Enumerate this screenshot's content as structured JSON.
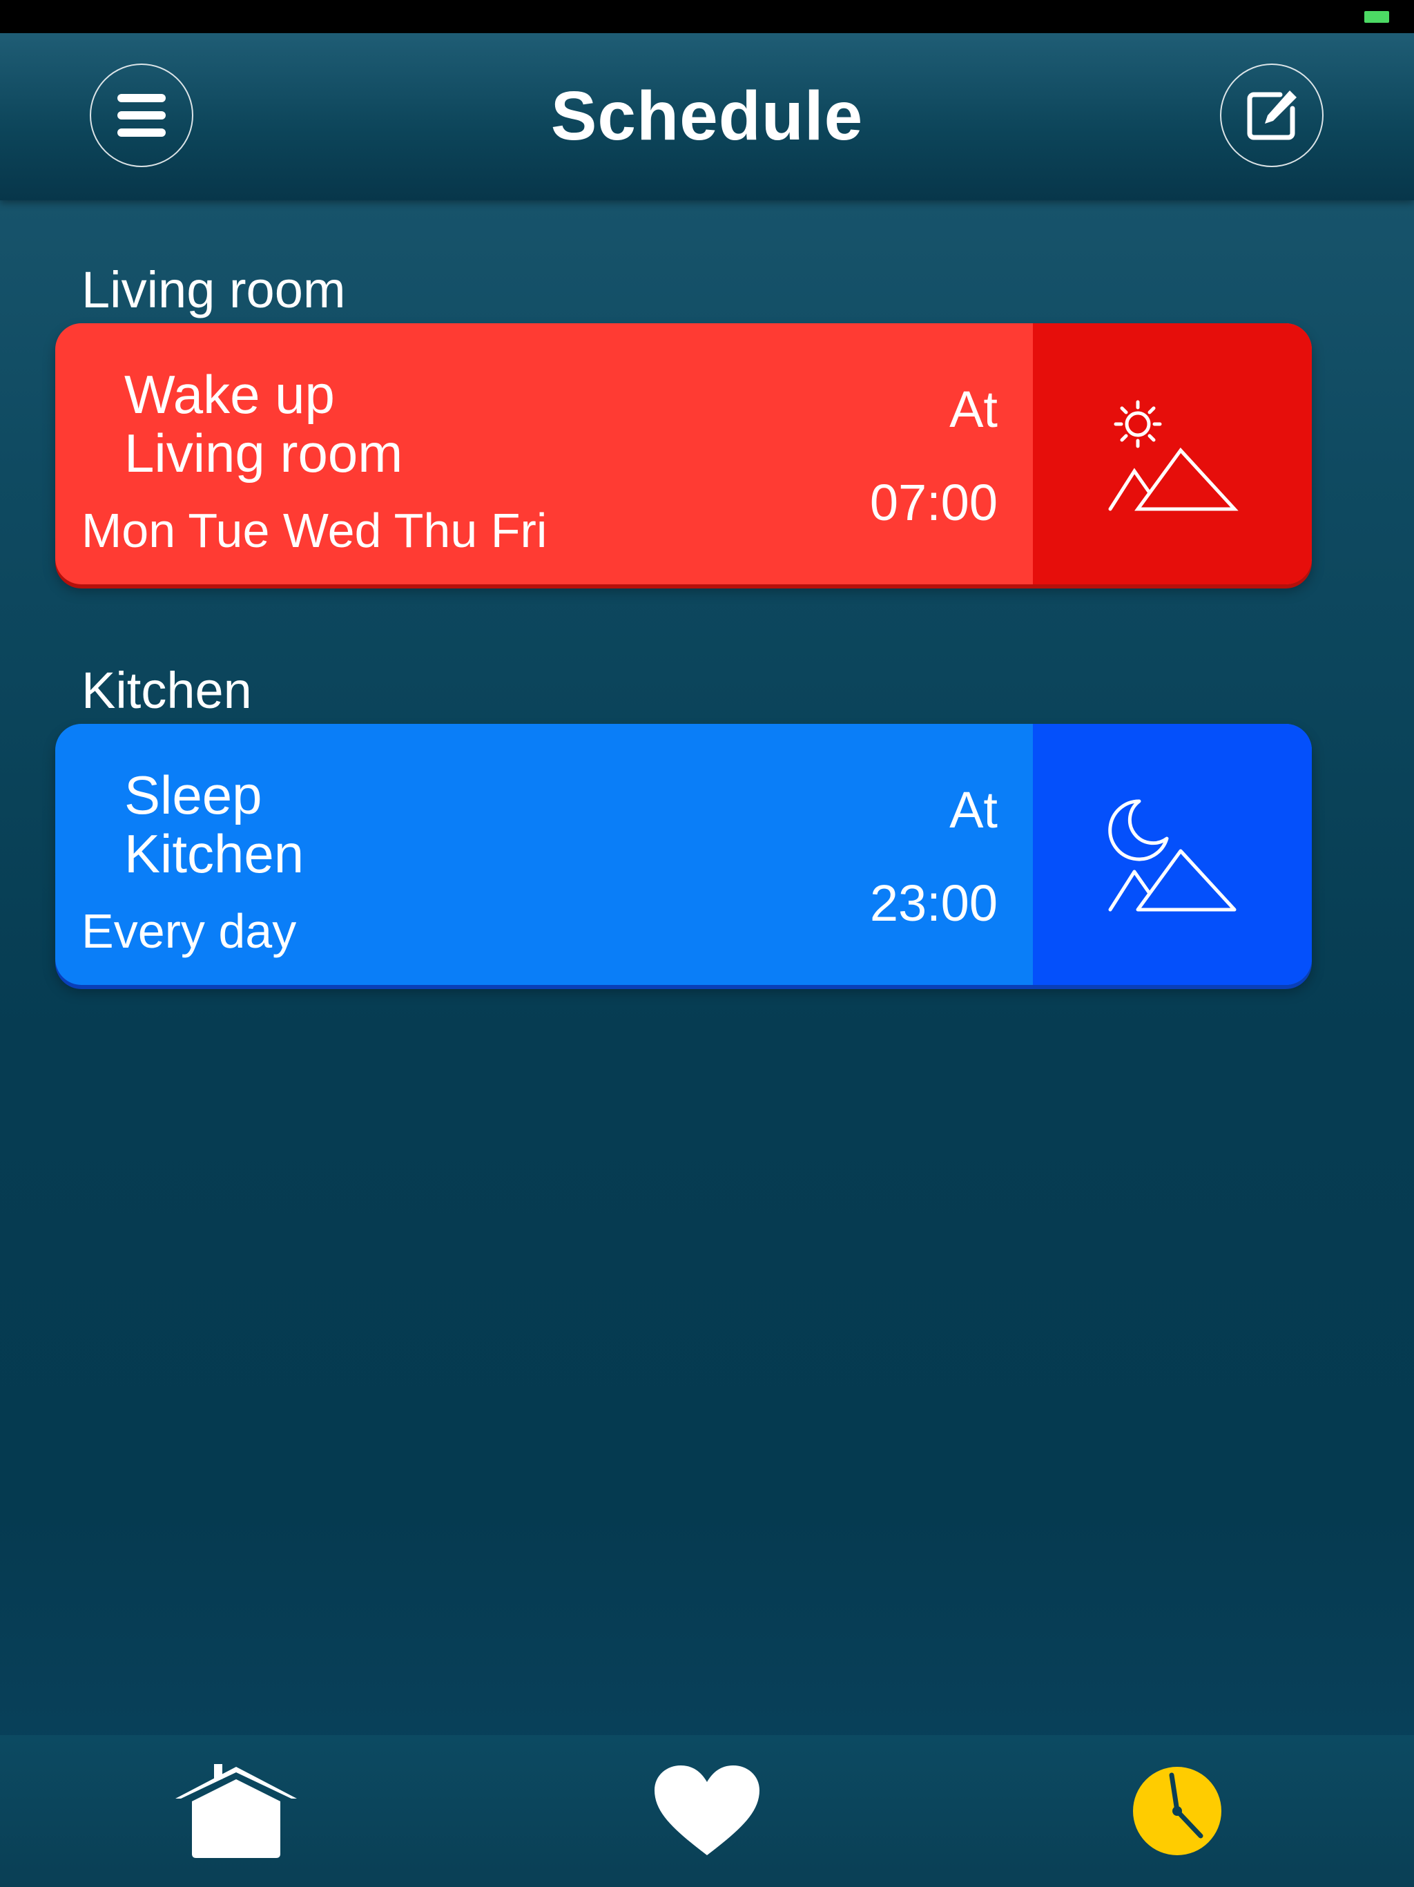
{
  "header": {
    "title": "Schedule",
    "menu_icon": "hamburger-menu-icon",
    "edit_icon": "edit-icon"
  },
  "schedules": [
    {
      "room_heading": "Living room",
      "name": "Wake up",
      "room": "Living room",
      "days": "Mon Tue Wed Thu Fri",
      "at_label": "At",
      "time": "07:00",
      "icon": "sunrise-mountain-icon",
      "color": "#ff3b33",
      "side_color": "#e60e0b"
    },
    {
      "room_heading": "Kitchen",
      "name": "Sleep",
      "room": "Kitchen",
      "days": "Every day",
      "at_label": "At",
      "time": "23:00",
      "icon": "moon-mountain-icon",
      "color": "#0a7ef8",
      "side_color": "#0450fb"
    }
  ],
  "tab_bar": {
    "tabs": [
      {
        "id": "home",
        "icon": "home-icon",
        "active": false
      },
      {
        "id": "favorites",
        "icon": "heart-icon",
        "active": false
      },
      {
        "id": "schedule",
        "icon": "clock-icon",
        "active": true
      }
    ],
    "active_color": "#ffcc00"
  }
}
